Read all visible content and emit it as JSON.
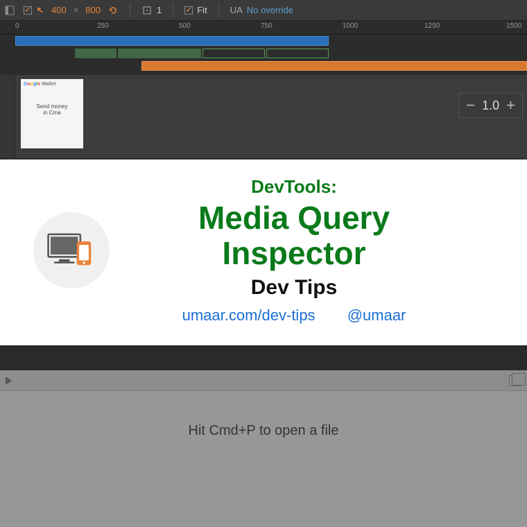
{
  "toolbar": {
    "width": "400",
    "height": "800",
    "dpr": "1",
    "fit_label": "Fit",
    "ua_label": "UA",
    "ua_value": "No override"
  },
  "ruler": {
    "ticks": [
      "0",
      "250",
      "500",
      "750",
      "1000",
      "1250",
      "1500"
    ]
  },
  "zoom": {
    "value": "1.0"
  },
  "preview": {
    "logo_text": "Google Wallet",
    "body_line1": "Send money",
    "body_line2": "in Cma"
  },
  "overlay": {
    "devtools": "DevTools:",
    "title_line1": "Media Query",
    "title_line2": "Inspector",
    "subtitle": "Dev Tips",
    "link_site": "umaar.com/dev-tips",
    "link_handle": "@umaar"
  },
  "bottom": {
    "hint": "Hit Cmd+P to open a file"
  }
}
